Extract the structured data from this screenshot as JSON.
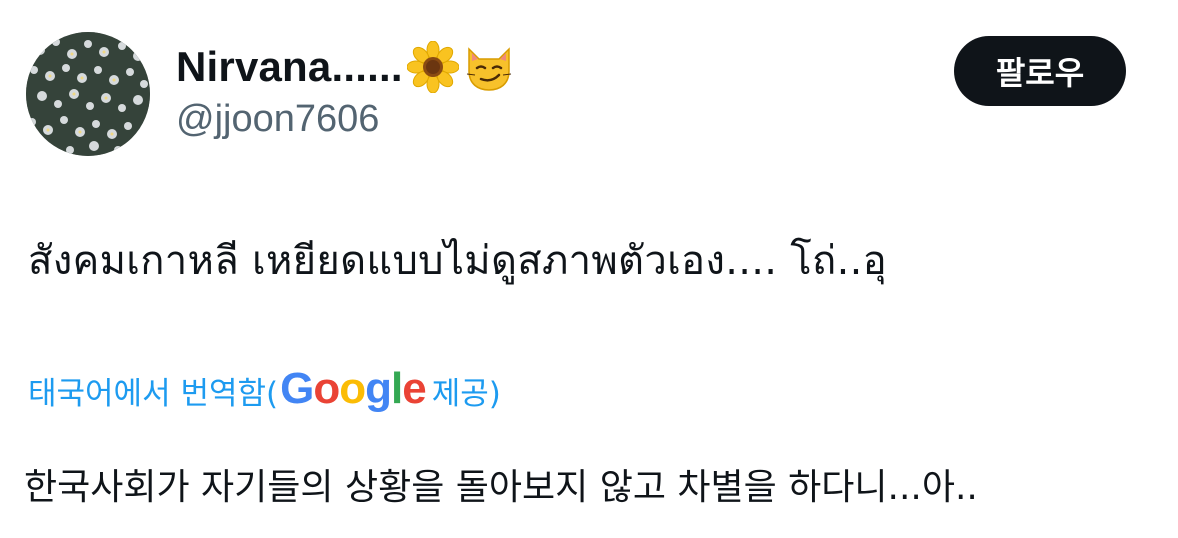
{
  "user": {
    "display_name": "Nirvana......",
    "name_emojis": [
      "sunflower-icon",
      "smirking-cat-icon"
    ],
    "handle": "@jjoon7606"
  },
  "follow_button": {
    "label": "팔로우"
  },
  "tweet": {
    "text": "สังคมเกาหลี เหยียดแบบไม่ดูสภาพตัวเอง.... โถ่..อุ"
  },
  "translation": {
    "link_label": "태국어에서 번역함(",
    "provider_logo_letters": [
      "G",
      "o",
      "o",
      "g",
      "l",
      "e"
    ],
    "provider_suffix": " 제공)",
    "translated_text": "한국사회가 자기들의 상황을 돌아보지 않고 차별을 하다니...아.."
  },
  "colors": {
    "text_primary": "#0f1419",
    "text_secondary": "#536471",
    "link_blue": "#1d9bf0",
    "button_bg": "#0f1419",
    "button_text": "#ffffff"
  }
}
